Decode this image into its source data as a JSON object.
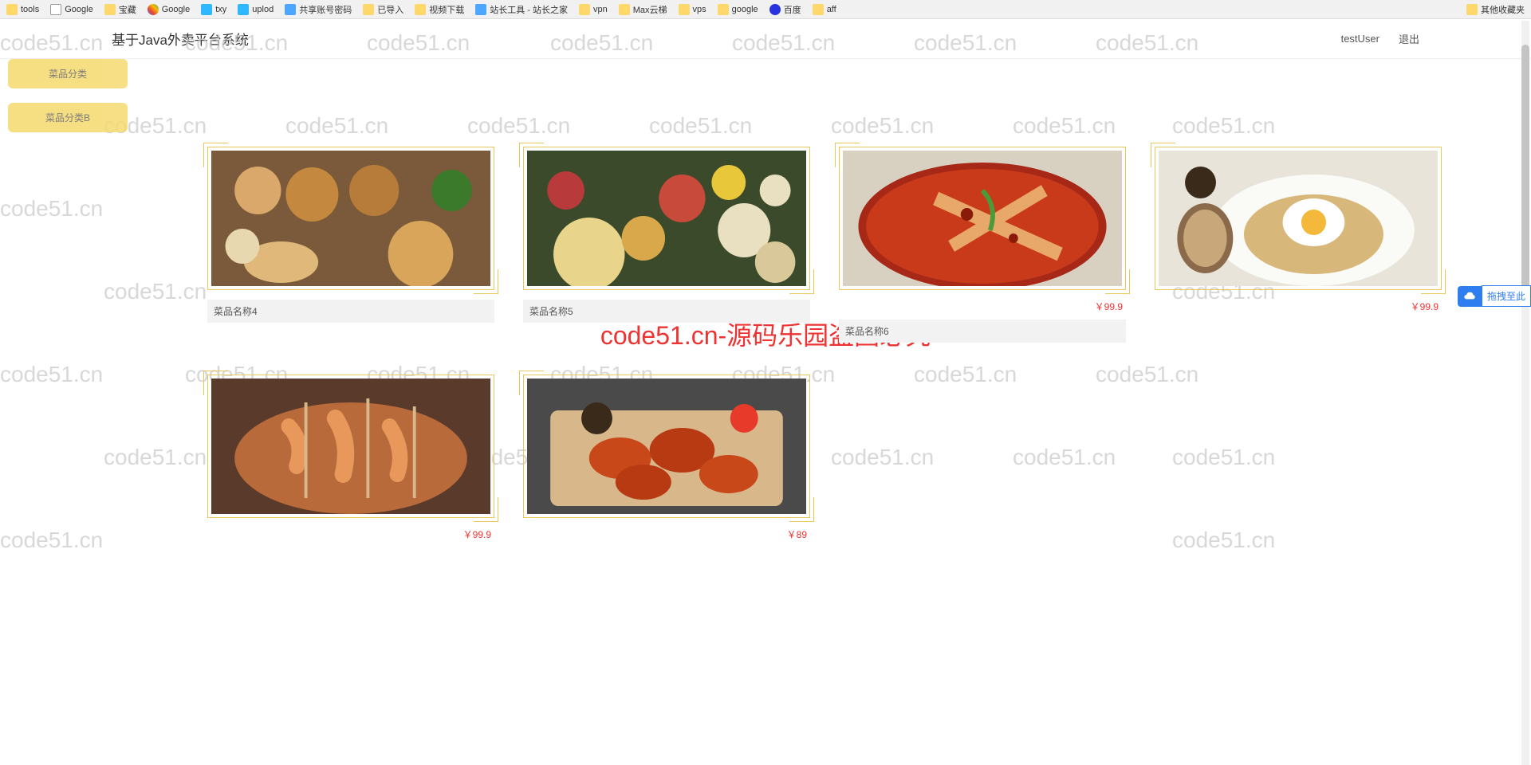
{
  "bookmarks": {
    "left": [
      {
        "label": "tools",
        "icon": "folder"
      },
      {
        "label": "Google",
        "icon": "page"
      },
      {
        "label": "宝藏",
        "icon": "folder"
      },
      {
        "label": "Google",
        "icon": "g"
      },
      {
        "label": "txy",
        "icon": "cyan"
      },
      {
        "label": "uplod",
        "icon": "cyan"
      },
      {
        "label": "共享账号密码",
        "icon": "blue"
      },
      {
        "label": "已导入",
        "icon": "folder"
      },
      {
        "label": "视频下载",
        "icon": "folder"
      },
      {
        "label": "站长工具 - 站长之家",
        "icon": "blue"
      },
      {
        "label": "vpn",
        "icon": "folder"
      },
      {
        "label": "Max云梯",
        "icon": "folder"
      },
      {
        "label": "vps",
        "icon": "folder"
      },
      {
        "label": "google",
        "icon": "folder"
      },
      {
        "label": "百度",
        "icon": "baidu"
      },
      {
        "label": "aff",
        "icon": "folder"
      }
    ],
    "right": {
      "label": "其他收藏夹",
      "icon": "folder"
    }
  },
  "header": {
    "title": "基于Java外卖平台系统",
    "user": "testUser",
    "logout": "退出"
  },
  "sidebar": {
    "items": [
      {
        "label": "菜品分类"
      },
      {
        "label": "菜品分类B"
      }
    ]
  },
  "watermark": {
    "text": "code51.cn",
    "center": "code51.cn-源码乐园盗图必究"
  },
  "dishes": [
    {
      "name": "菜品名称4",
      "price": "",
      "img": "spread1"
    },
    {
      "name": "菜品名称5",
      "price": "",
      "img": "spread2"
    },
    {
      "name": "菜品名称6",
      "price": "￥99.9",
      "img": "spicy"
    },
    {
      "name": "",
      "price": "￥99.9",
      "img": "eggrice"
    },
    {
      "name": "",
      "price": "￥99.9",
      "img": "shrimp"
    },
    {
      "name": "",
      "price": "￥89",
      "img": "wings"
    }
  ],
  "dragBadge": {
    "text": "拖拽至此"
  }
}
